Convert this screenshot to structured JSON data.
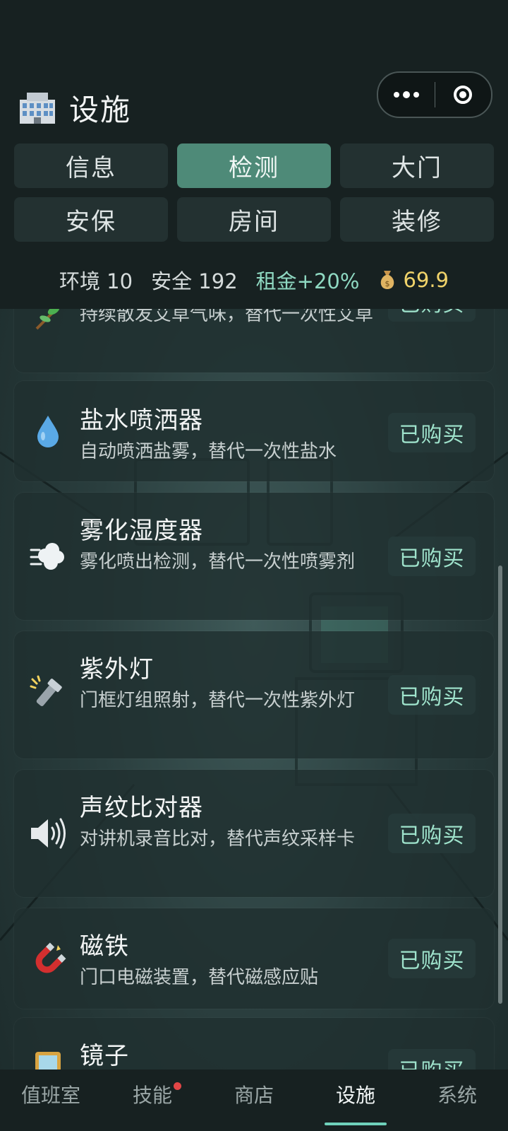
{
  "header": {
    "title": "设施",
    "title_icon": "office-building-icon",
    "capsule": {
      "more_icon": "more-dots-icon",
      "close_icon": "target-circle-icon"
    }
  },
  "tabs": [
    {
      "label": "信息",
      "active": false
    },
    {
      "label": "检测",
      "active": true
    },
    {
      "label": "大门",
      "active": false
    },
    {
      "label": "安保",
      "active": false
    },
    {
      "label": "房间",
      "active": false
    },
    {
      "label": "装修",
      "active": false
    }
  ],
  "stats": {
    "environment": "环境 10",
    "safety": "安全 192",
    "rent": "租金+20%",
    "money_icon": "money-bag-icon",
    "money": "69.9"
  },
  "items": [
    {
      "name": "",
      "desc": "持续散发艾草气味，替代一次性艾草",
      "button": "已购买",
      "icon": "herb-icon"
    },
    {
      "name": "盐水喷洒器",
      "desc": "自动喷洒盐雾，替代一次性盐水",
      "button": "已购买",
      "icon": "water-drop-icon"
    },
    {
      "name": "雾化湿度器",
      "desc": "雾化喷出检测，替代一次性喷雾剂",
      "button": "已购买",
      "icon": "mist-icon"
    },
    {
      "name": "紫外灯",
      "desc": "门框灯组照射，替代一次性紫外灯",
      "button": "已购买",
      "icon": "flashlight-icon"
    },
    {
      "name": "声纹比对器",
      "desc": "对讲机录音比对，替代声纹采样卡",
      "button": "已购买",
      "icon": "speaker-icon"
    },
    {
      "name": "磁铁",
      "desc": "门口电磁装置，替代磁感应贴",
      "button": "已购买",
      "icon": "magnet-icon"
    },
    {
      "name": "镜子",
      "desc": "",
      "button": "已购买",
      "icon": "mirror-icon"
    }
  ],
  "bottom_nav": [
    {
      "label": "值班室",
      "active": false,
      "badge": false
    },
    {
      "label": "技能",
      "active": false,
      "badge": true
    },
    {
      "label": "商店",
      "active": false,
      "badge": false
    },
    {
      "label": "设施",
      "active": true,
      "badge": false
    },
    {
      "label": "系统",
      "active": false,
      "badge": false
    }
  ],
  "colors": {
    "accent": "#4e8a78",
    "accent_text": "#9fe3cc",
    "money": "#f0d36a",
    "badge": "#e24646"
  }
}
